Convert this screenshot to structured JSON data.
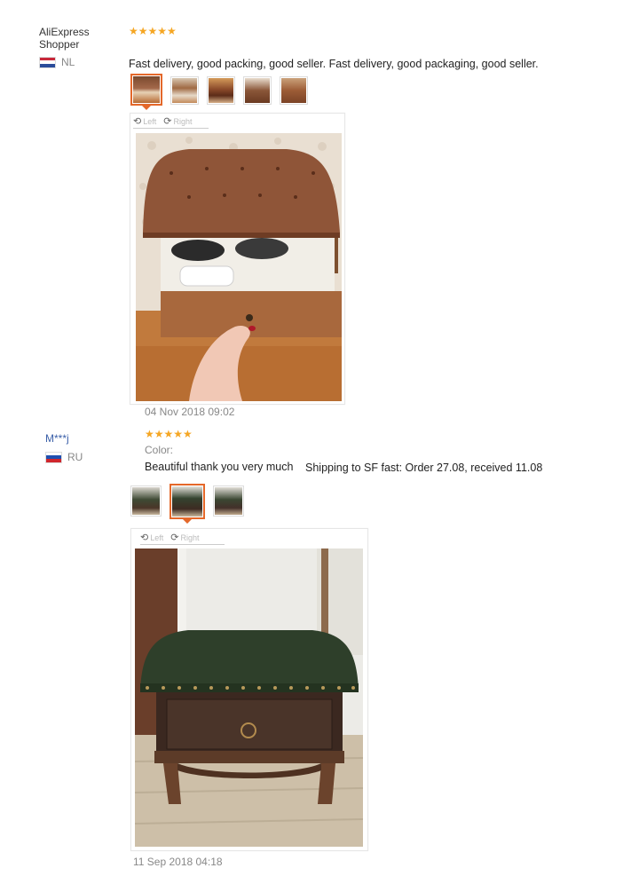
{
  "reviews": [
    {
      "user": "AliExpress Shopper",
      "country": "NL",
      "stars": "★★★★★",
      "text": "Fast delivery, good packing, good seller. Fast delivery, good packaging, good seller.",
      "rotate_left": "Left",
      "rotate_right": "Right",
      "date": "04 Nov 2018 09:02"
    },
    {
      "user": "M***j",
      "country": "RU",
      "stars": "★★★★★",
      "color_label": "Color:",
      "text": "Beautiful thank you very much",
      "shipping": "Shipping to SF fast: Order 27.08, received 11.08",
      "rotate_left": "Left",
      "rotate_right": "Right",
      "date": "11 Sep 2018 04:18"
    }
  ],
  "colors": {
    "accent": "#e4682a",
    "star": "#f5a623",
    "masked_user": "#3a5fa8"
  },
  "icons": [
    "rotate-left-icon",
    "rotate-right-icon",
    "flag-nl-icon",
    "flag-ru-icon"
  ]
}
